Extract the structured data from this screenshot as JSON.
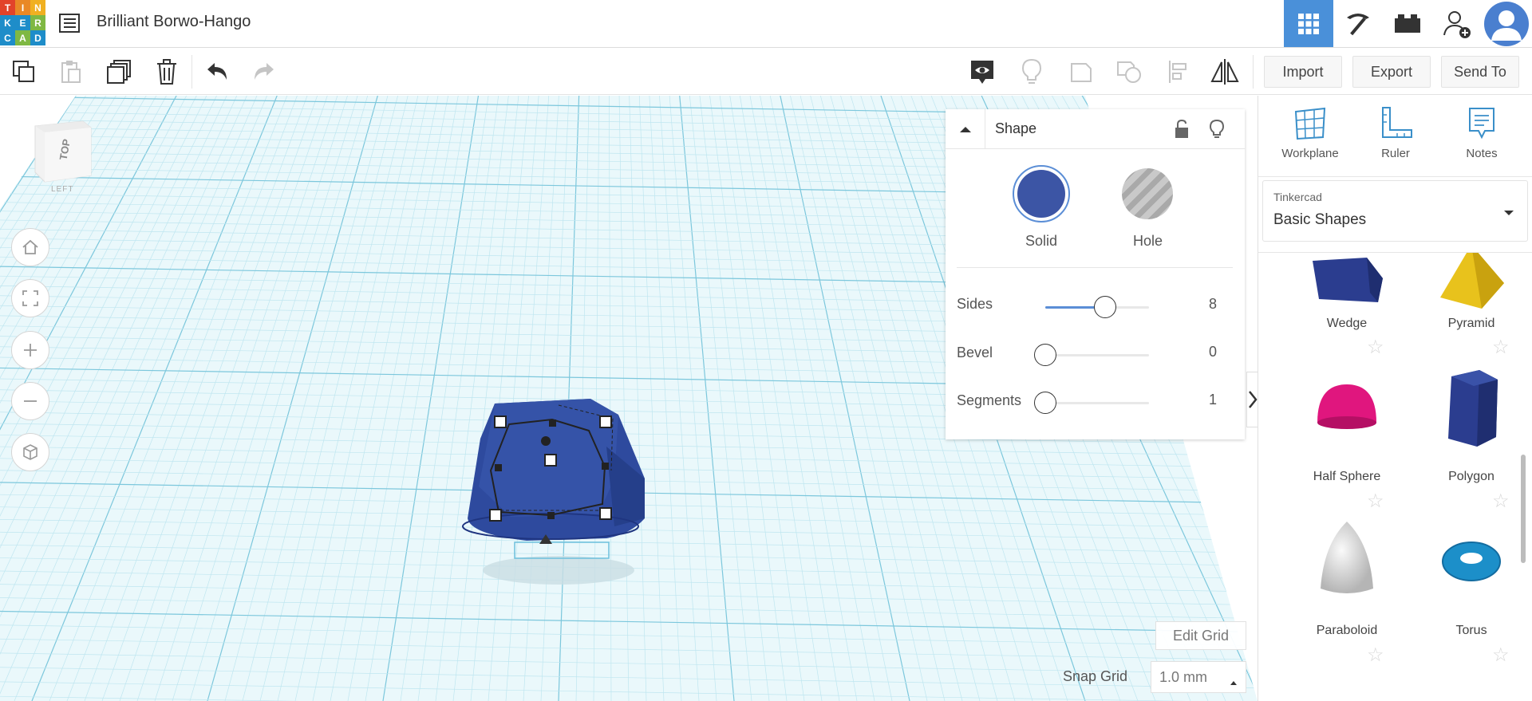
{
  "header": {
    "logo_letters": [
      "T",
      "I",
      "N",
      "K",
      "E",
      "R",
      "C",
      "A",
      "D"
    ],
    "title": "Brilliant Borwo-Hango"
  },
  "toolbar": {
    "import_label": "Import",
    "export_label": "Export",
    "send_to_label": "Send To"
  },
  "view_cube": {
    "top_label": "TOP",
    "left_label": "LEFT"
  },
  "inspector": {
    "title": "Shape",
    "solid_label": "Solid",
    "hole_label": "Hole",
    "solid_color": "#3c55a5",
    "params": [
      {
        "label": "Sides",
        "value": "8",
        "fraction": 0.58
      },
      {
        "label": "Bevel",
        "value": "0",
        "fraction": 0.0
      },
      {
        "label": "Segments",
        "value": "1",
        "fraction": 0.0
      }
    ]
  },
  "right_panel": {
    "tools": [
      {
        "label": "Workplane",
        "icon": "workplane-icon"
      },
      {
        "label": "Ruler",
        "icon": "ruler-icon"
      },
      {
        "label": "Notes",
        "icon": "notes-icon"
      }
    ],
    "library_source": "Tinkercad",
    "library_name": "Basic Shapes",
    "shapes": [
      {
        "name": "Wedge",
        "color": "#2b3d8f"
      },
      {
        "name": "Pyramid",
        "color": "#e8c21c"
      },
      {
        "name": "Half Sphere",
        "color": "#e0167e"
      },
      {
        "name": "Polygon",
        "color": "#2b3d8f"
      },
      {
        "name": "Paraboloid",
        "color": "#d9d9d9"
      },
      {
        "name": "Torus",
        "color": "#1c8fc9"
      }
    ]
  },
  "grid_controls": {
    "edit_grid_label": "Edit Grid",
    "snap_grid_label": "Snap Grid",
    "snap_grid_value": "1.0 mm"
  },
  "colors": {
    "accent": "#4a90d9",
    "grid_minor": "#bfe6f0",
    "grid_major": "#7cc7dc"
  }
}
